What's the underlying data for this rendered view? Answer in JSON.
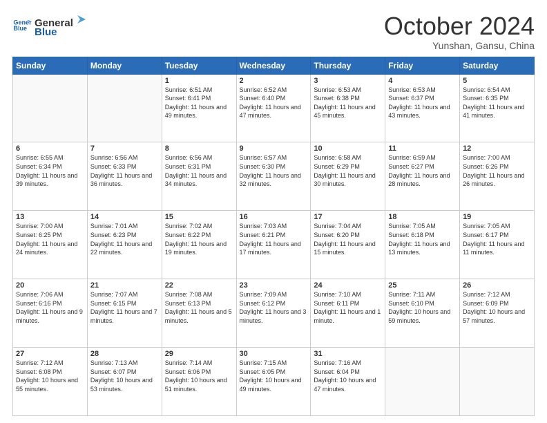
{
  "logo": {
    "line1": "General",
    "line2": "Blue"
  },
  "header": {
    "month": "October 2024",
    "location": "Yunshan, Gansu, China"
  },
  "weekdays": [
    "Sunday",
    "Monday",
    "Tuesday",
    "Wednesday",
    "Thursday",
    "Friday",
    "Saturday"
  ],
  "weeks": [
    [
      {
        "day": "",
        "empty": true
      },
      {
        "day": "",
        "empty": true
      },
      {
        "day": "1",
        "sunrise": "6:51 AM",
        "sunset": "6:41 PM",
        "daylight": "11 hours and 49 minutes."
      },
      {
        "day": "2",
        "sunrise": "6:52 AM",
        "sunset": "6:40 PM",
        "daylight": "11 hours and 47 minutes."
      },
      {
        "day": "3",
        "sunrise": "6:53 AM",
        "sunset": "6:38 PM",
        "daylight": "11 hours and 45 minutes."
      },
      {
        "day": "4",
        "sunrise": "6:53 AM",
        "sunset": "6:37 PM",
        "daylight": "11 hours and 43 minutes."
      },
      {
        "day": "5",
        "sunrise": "6:54 AM",
        "sunset": "6:35 PM",
        "daylight": "11 hours and 41 minutes."
      }
    ],
    [
      {
        "day": "6",
        "sunrise": "6:55 AM",
        "sunset": "6:34 PM",
        "daylight": "11 hours and 39 minutes."
      },
      {
        "day": "7",
        "sunrise": "6:56 AM",
        "sunset": "6:33 PM",
        "daylight": "11 hours and 36 minutes."
      },
      {
        "day": "8",
        "sunrise": "6:56 AM",
        "sunset": "6:31 PM",
        "daylight": "11 hours and 34 minutes."
      },
      {
        "day": "9",
        "sunrise": "6:57 AM",
        "sunset": "6:30 PM",
        "daylight": "11 hours and 32 minutes."
      },
      {
        "day": "10",
        "sunrise": "6:58 AM",
        "sunset": "6:29 PM",
        "daylight": "11 hours and 30 minutes."
      },
      {
        "day": "11",
        "sunrise": "6:59 AM",
        "sunset": "6:27 PM",
        "daylight": "11 hours and 28 minutes."
      },
      {
        "day": "12",
        "sunrise": "7:00 AM",
        "sunset": "6:26 PM",
        "daylight": "11 hours and 26 minutes."
      }
    ],
    [
      {
        "day": "13",
        "sunrise": "7:00 AM",
        "sunset": "6:25 PM",
        "daylight": "11 hours and 24 minutes."
      },
      {
        "day": "14",
        "sunrise": "7:01 AM",
        "sunset": "6:23 PM",
        "daylight": "11 hours and 22 minutes."
      },
      {
        "day": "15",
        "sunrise": "7:02 AM",
        "sunset": "6:22 PM",
        "daylight": "11 hours and 19 minutes."
      },
      {
        "day": "16",
        "sunrise": "7:03 AM",
        "sunset": "6:21 PM",
        "daylight": "11 hours and 17 minutes."
      },
      {
        "day": "17",
        "sunrise": "7:04 AM",
        "sunset": "6:20 PM",
        "daylight": "11 hours and 15 minutes."
      },
      {
        "day": "18",
        "sunrise": "7:05 AM",
        "sunset": "6:18 PM",
        "daylight": "11 hours and 13 minutes."
      },
      {
        "day": "19",
        "sunrise": "7:05 AM",
        "sunset": "6:17 PM",
        "daylight": "11 hours and 11 minutes."
      }
    ],
    [
      {
        "day": "20",
        "sunrise": "7:06 AM",
        "sunset": "6:16 PM",
        "daylight": "11 hours and 9 minutes."
      },
      {
        "day": "21",
        "sunrise": "7:07 AM",
        "sunset": "6:15 PM",
        "daylight": "11 hours and 7 minutes."
      },
      {
        "day": "22",
        "sunrise": "7:08 AM",
        "sunset": "6:13 PM",
        "daylight": "11 hours and 5 minutes."
      },
      {
        "day": "23",
        "sunrise": "7:09 AM",
        "sunset": "6:12 PM",
        "daylight": "11 hours and 3 minutes."
      },
      {
        "day": "24",
        "sunrise": "7:10 AM",
        "sunset": "6:11 PM",
        "daylight": "11 hours and 1 minute."
      },
      {
        "day": "25",
        "sunrise": "7:11 AM",
        "sunset": "6:10 PM",
        "daylight": "10 hours and 59 minutes."
      },
      {
        "day": "26",
        "sunrise": "7:12 AM",
        "sunset": "6:09 PM",
        "daylight": "10 hours and 57 minutes."
      }
    ],
    [
      {
        "day": "27",
        "sunrise": "7:12 AM",
        "sunset": "6:08 PM",
        "daylight": "10 hours and 55 minutes."
      },
      {
        "day": "28",
        "sunrise": "7:13 AM",
        "sunset": "6:07 PM",
        "daylight": "10 hours and 53 minutes."
      },
      {
        "day": "29",
        "sunrise": "7:14 AM",
        "sunset": "6:06 PM",
        "daylight": "10 hours and 51 minutes."
      },
      {
        "day": "30",
        "sunrise": "7:15 AM",
        "sunset": "6:05 PM",
        "daylight": "10 hours and 49 minutes."
      },
      {
        "day": "31",
        "sunrise": "7:16 AM",
        "sunset": "6:04 PM",
        "daylight": "10 hours and 47 minutes."
      },
      {
        "day": "",
        "empty": true
      },
      {
        "day": "",
        "empty": true
      }
    ]
  ],
  "labels": {
    "sunrise": "Sunrise:",
    "sunset": "Sunset:",
    "daylight": "Daylight:"
  }
}
